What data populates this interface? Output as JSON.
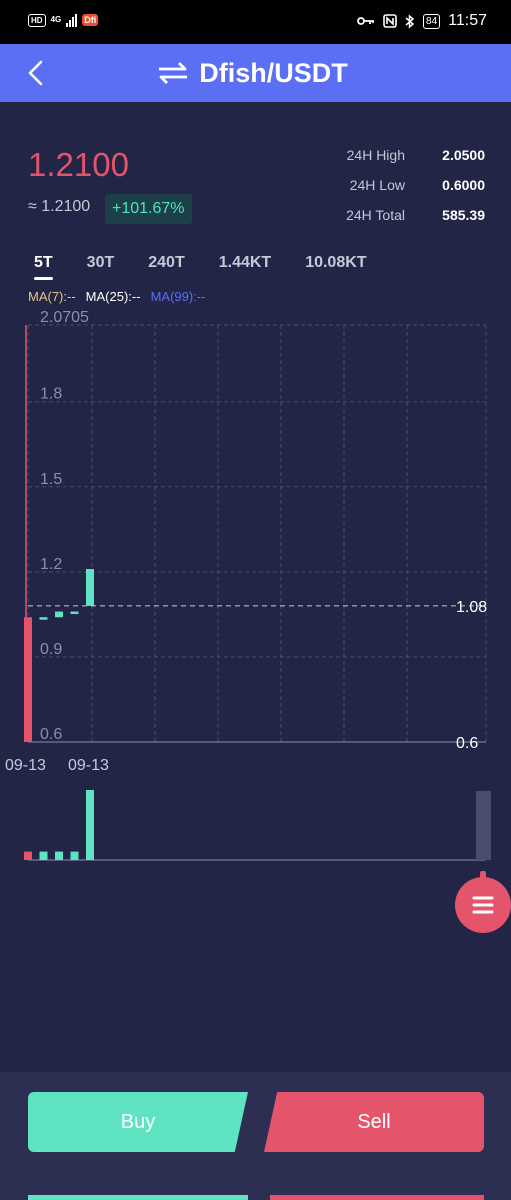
{
  "status_bar": {
    "hd": "HD",
    "net": "4G",
    "app_badge": "Dfi",
    "battery": "84",
    "time": "11:57"
  },
  "header": {
    "title": "Dfish/USDT",
    "swap_icon": "swap-icon",
    "back_icon": "chevron-left-icon"
  },
  "ticker": {
    "price": "1.2100",
    "approx": "≈ 1.2100",
    "change": "+101.67%",
    "high_label": "24H High",
    "high_value": "2.0500",
    "low_label": "24H Low",
    "low_value": "0.6000",
    "total_label": "24H Total",
    "total_value": "585.39"
  },
  "tabs": [
    {
      "label": "5T",
      "active": true
    },
    {
      "label": "30T",
      "active": false
    },
    {
      "label": "240T",
      "active": false
    },
    {
      "label": "1.44KT",
      "active": false
    },
    {
      "label": "10.08KT",
      "active": false
    }
  ],
  "ma": {
    "ma7": "MA(7):--",
    "ma25": "MA(25):--",
    "ma99": "MA(99):--"
  },
  "colors": {
    "up": "#5fe3c3",
    "down": "#e4556b",
    "ma7": "#e8c48a",
    "ma25": "#ffffff",
    "ma99": "#5b6ff5",
    "accent": "#5b6ff5"
  },
  "chart_data": {
    "type": "candlestick",
    "y_ticks": [
      "2.0705",
      "1.8",
      "1.5",
      "1.2",
      "0.9",
      "0.6"
    ],
    "y_tick_values": [
      2.0705,
      1.8,
      1.5,
      1.2,
      0.9,
      0.6
    ],
    "ylim": [
      0.6,
      2.0705
    ],
    "x_ticks": [
      "09-13",
      "09-13"
    ],
    "right_labels": [
      {
        "text": "1.08",
        "value": 1.08
      },
      {
        "text": "0.6",
        "value": 0.6
      }
    ],
    "candles": [
      {
        "open": 0.6,
        "close": 1.04,
        "high": 2.0705,
        "low": 0.6,
        "dir": "down"
      },
      {
        "open": 1.04,
        "close": 1.04,
        "high": 1.04,
        "low": 1.04,
        "dir": "up"
      },
      {
        "open": 1.04,
        "close": 1.06,
        "high": 1.06,
        "low": 1.04,
        "dir": "up"
      },
      {
        "open": 1.06,
        "close": 1.06,
        "high": 1.06,
        "low": 1.06,
        "dir": "up"
      },
      {
        "open": 1.08,
        "close": 1.21,
        "high": 1.21,
        "low": 1.08,
        "dir": "up"
      }
    ],
    "volumes": [
      {
        "value": 0.12,
        "dir": "down"
      },
      {
        "value": 0.12,
        "dir": "up"
      },
      {
        "value": 0.12,
        "dir": "up"
      },
      {
        "value": 0.12,
        "dir": "up"
      },
      {
        "value": 1.0,
        "dir": "up"
      }
    ]
  },
  "buttons": {
    "buy": "Buy",
    "sell": "Sell",
    "menu_icon": "menu-icon"
  }
}
